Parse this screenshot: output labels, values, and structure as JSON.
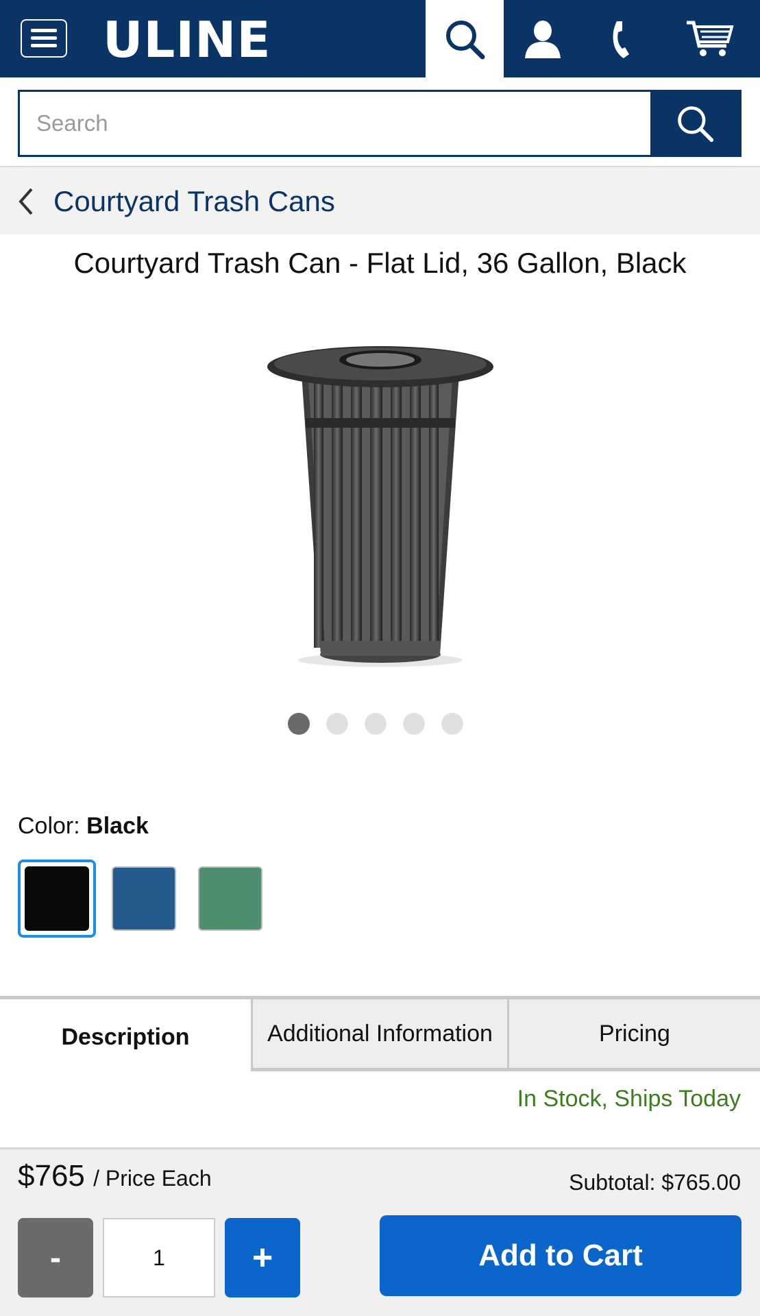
{
  "header": {
    "logo": "ULINE",
    "icons": [
      "menu-icon",
      "search-icon",
      "account-icon",
      "phone-icon",
      "cart-icon"
    ]
  },
  "search": {
    "placeholder": "Search",
    "value": ""
  },
  "breadcrumb": {
    "label": "Courtyard Trash Cans"
  },
  "product": {
    "title": "Courtyard Trash Can - Flat Lid, 36 Gallon, Black",
    "image_count": 5,
    "active_image": 1
  },
  "color": {
    "label": "Color:",
    "selected": "Black",
    "options": [
      {
        "name": "Black",
        "hex": "#0a0a0a"
      },
      {
        "name": "Blue",
        "hex": "#245a8e"
      },
      {
        "name": "Green",
        "hex": "#4d8e6c"
      }
    ]
  },
  "tabs": [
    {
      "label": "Description",
      "active": true
    },
    {
      "label": "Additional Information",
      "active": false
    },
    {
      "label": "Pricing",
      "active": false
    }
  ],
  "stock": {
    "text": "In Stock, Ships Today",
    "color": "#3e7d1f"
  },
  "purchase": {
    "price": "$765",
    "price_each": "/ Price Each",
    "subtotal": "Subtotal: $765.00",
    "minus": "-",
    "quantity": "1",
    "plus": "+",
    "add_to_cart": "Add to Cart"
  },
  "colors": {
    "brand": "#0b3466",
    "accent": "#0b66cc",
    "selected_border": "#1d8fe1"
  }
}
